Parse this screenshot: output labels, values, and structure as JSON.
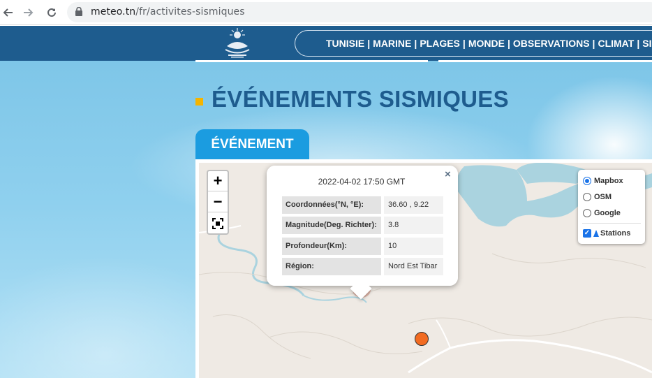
{
  "browser": {
    "url_host": "meteo.tn",
    "url_path": "/fr/activites-sismiques"
  },
  "header": {
    "nav_items": [
      "TUNISIE",
      "MARINE",
      "PLAGES",
      "MONDE",
      "OBSERVATIONS",
      "CLIMAT",
      "SISMO"
    ],
    "nav_separator": "|"
  },
  "page": {
    "title": "ÉVÉNEMENTS SISMIQUES",
    "tab_label": "ÉVÉNEMENT"
  },
  "map": {
    "zoom_in": "+",
    "zoom_out": "−",
    "popup": {
      "title": "2022-04-02 17:50 GMT",
      "close": "×",
      "rows": [
        {
          "label": "Coordonnées(°N, °E):",
          "value": "36.60 , 9.22"
        },
        {
          "label": "Magnitude(Deg. Richter):",
          "value": "3.8"
        },
        {
          "label": "Profondeur(Km):",
          "value": "10"
        },
        {
          "label": "Région:",
          "value": "Nord Est Tibar"
        }
      ]
    },
    "layers": {
      "options": [
        {
          "label": "Mapbox",
          "selected": true
        },
        {
          "label": "OSM",
          "selected": false
        },
        {
          "label": "Google",
          "selected": false
        }
      ],
      "overlay_label": "Stations",
      "overlay_checked": true
    },
    "colors": {
      "water": "#aad3df",
      "land": "#efeae4",
      "marker": "#f26b21",
      "accent": "#1e5c8e"
    }
  }
}
